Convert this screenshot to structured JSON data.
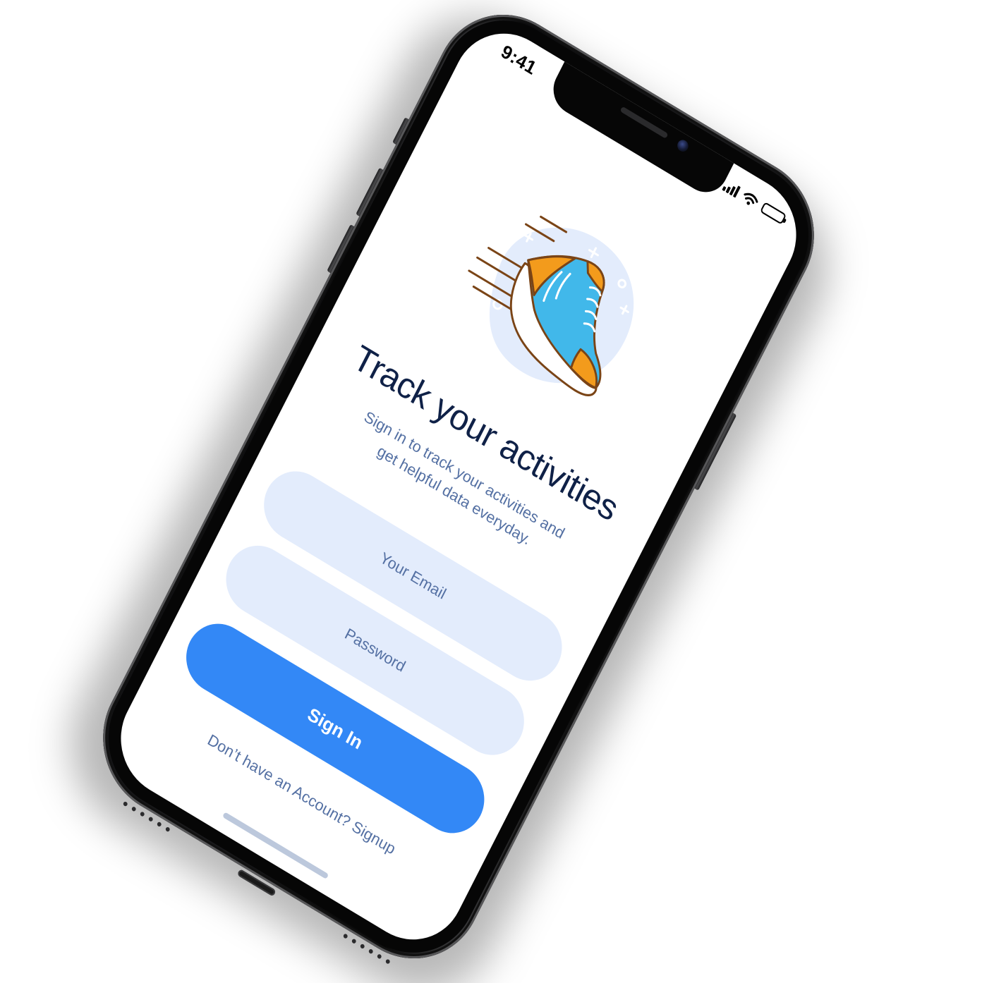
{
  "status_bar": {
    "time": "9:41",
    "signal_icon": "cellular-signal-icon",
    "wifi_icon": "wifi-icon",
    "battery_icon": "battery-icon",
    "battery_level": 1.0
  },
  "illustration": {
    "icon": "running-shoe-icon",
    "colors": {
      "blob": "#e3ecfc",
      "shoe_upper": "#41b8ea",
      "shoe_accent": "#f39b1c",
      "sole": "#ffffff",
      "outline": "#7a4416"
    }
  },
  "onboarding": {
    "title": "Track your activities",
    "subtitle": "Sign in to track your activities and get helpful data everyday."
  },
  "form": {
    "email_placeholder": "Your Email",
    "password_placeholder": "Password",
    "email_value": "",
    "password_value": "",
    "signin_label": "Sign In",
    "signup_text": "Don’t have an Account? Signup"
  },
  "colors": {
    "primary": "#3388f6",
    "field_background": "#e3ecfc",
    "title": "#0f2147",
    "muted_text": "#5470a3",
    "home_indicator": "#bcc8dc"
  }
}
